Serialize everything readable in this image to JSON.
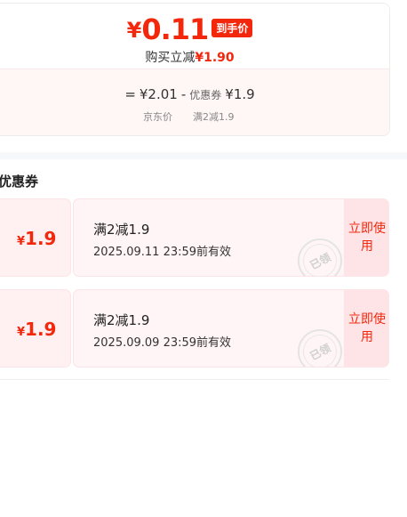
{
  "price_card": {
    "currency": "¥",
    "final_price": "0.11",
    "final_tag": "到手价",
    "reduce_label": "购买立减",
    "reduce_amount": "¥1.90",
    "formula_equals": "=",
    "original_price": "¥2.01",
    "minus": "-",
    "coupon_label": "优惠券",
    "coupon_price": "¥1.9",
    "sub_original": "京东价",
    "sub_coupon": "满2减1.9"
  },
  "section": {
    "title": "优惠券"
  },
  "coupons": [
    {
      "currency": "¥",
      "amount": "1.9",
      "title": "满2减1.9",
      "expiry": "2025.09.11 23:59前有效",
      "stamp": "已领",
      "action": "立即使用"
    },
    {
      "currency": "¥",
      "amount": "1.9",
      "title": "满2减1.9",
      "expiry": "2025.09.09 23:59前有效",
      "stamp": "已领",
      "action": "立即使用"
    }
  ],
  "colors": {
    "accent": "#f2270c",
    "coupon_bg": "#fff5f6",
    "button_bg": "#ffe4e7"
  }
}
